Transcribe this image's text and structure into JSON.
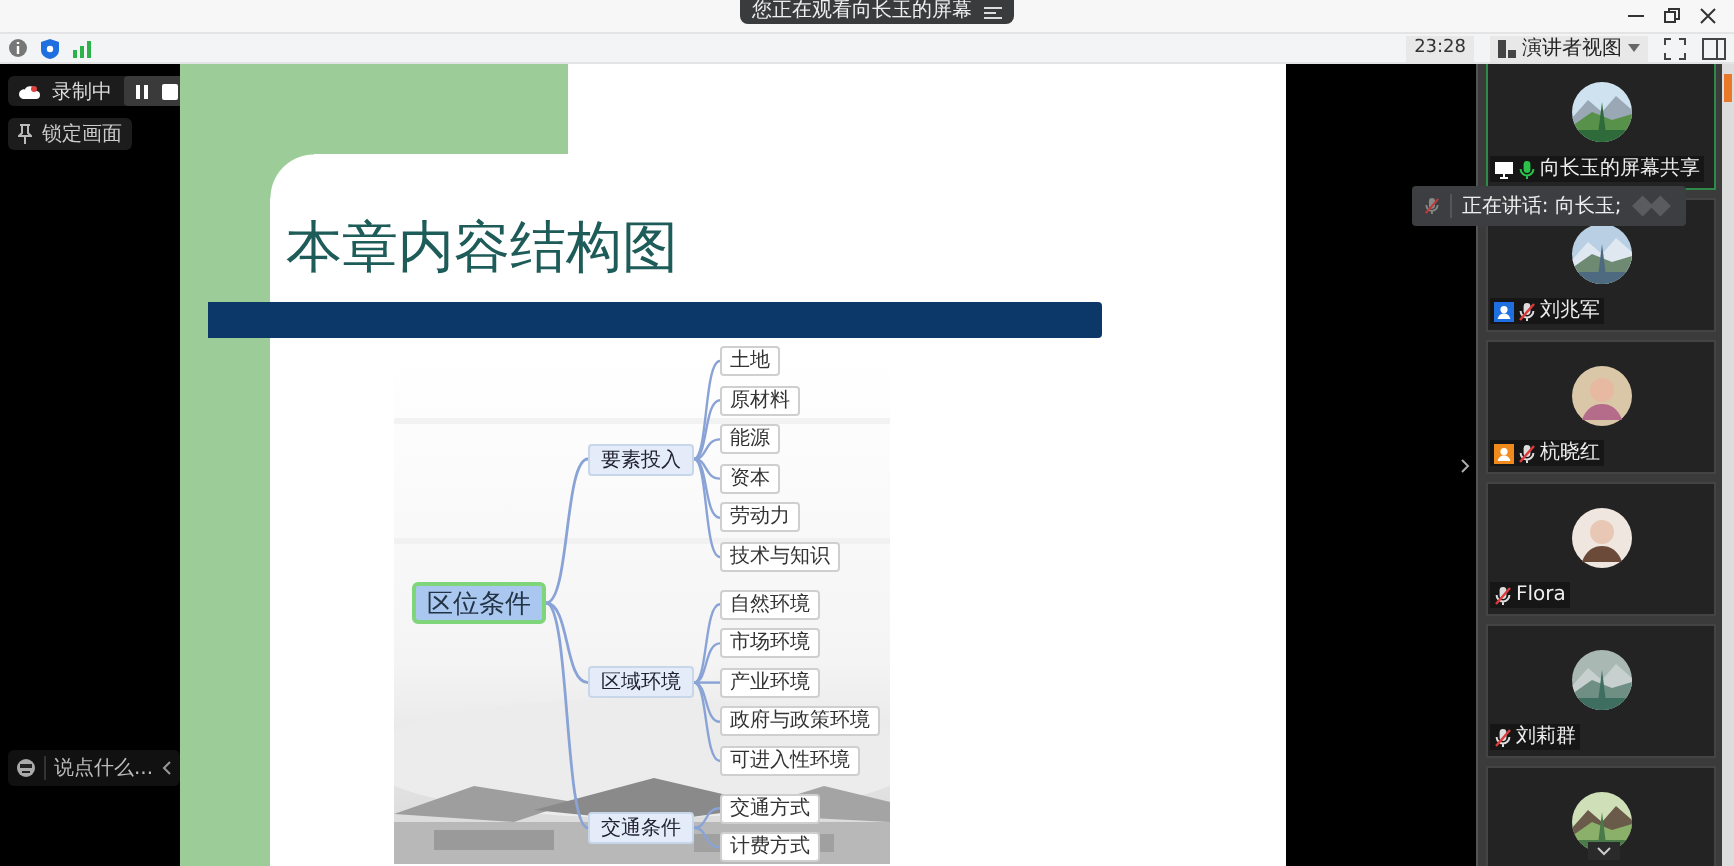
{
  "title_bar": {
    "banner": "您正在观看向长玉的屏幕"
  },
  "toolbar": {
    "time": "23:28",
    "view_mode": "演讲者视图"
  },
  "recording": {
    "status": "录制中"
  },
  "lock_button": "锁定画面",
  "chat": {
    "placeholder": "说点什么..."
  },
  "slide": {
    "title": "本章内容结构图",
    "mindmap": {
      "root": "区位条件",
      "branches": [
        {
          "label": "要素投入",
          "children": [
            "土地",
            "原材料",
            "能源",
            "资本",
            "劳动力",
            "技术与知识"
          ]
        },
        {
          "label": "区域环境",
          "children": [
            "自然环境",
            "市场环境",
            "产业环境",
            "政府与政策环境",
            "可进入性环境"
          ]
        },
        {
          "label": "交通条件",
          "children": [
            "交通方式",
            "计费方式"
          ]
        }
      ]
    }
  },
  "speaking_tooltip": "正在讲话: 向长玉;",
  "participants": [
    {
      "name": "向长玉的屏幕共享",
      "kind": "picture",
      "highlighted": true,
      "sharing": true,
      "muted": false
    },
    {
      "name": "刘兆军",
      "kind": "picture",
      "highlighted": false,
      "sharing": false,
      "muted": true,
      "color": "#1e6fe0"
    },
    {
      "name": "杭晓红",
      "kind": "figure",
      "highlighted": false,
      "sharing": false,
      "muted": true,
      "color": "#f08a1c"
    },
    {
      "name": "Flora",
      "kind": "figure",
      "highlighted": false,
      "sharing": false,
      "muted": true
    },
    {
      "name": "刘莉群",
      "kind": "picture",
      "highlighted": false,
      "sharing": false,
      "muted": true
    },
    {
      "kind": "picture",
      "highlighted": false
    }
  ]
}
